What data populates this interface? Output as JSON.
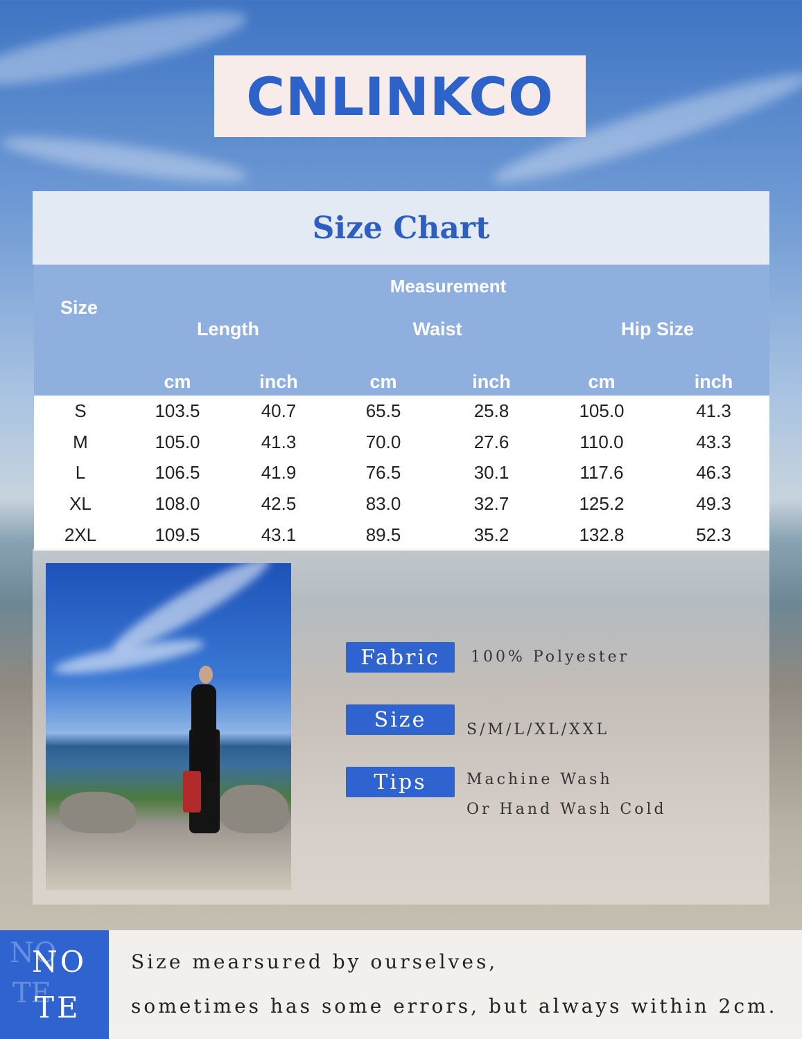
{
  "brand": {
    "name": "CNLINKCO"
  },
  "size_chart": {
    "title": "Size Chart",
    "header_measurement": "Measurement",
    "header_size": "Size",
    "groups": [
      "Length",
      "Waist",
      "Hip Size"
    ],
    "units": [
      "cm",
      "inch",
      "cm",
      "inch",
      "cm",
      "inch"
    ],
    "rows": [
      {
        "size": "S",
        "values": [
          "103.5",
          "40.7",
          "65.5",
          "25.8",
          "105.0",
          "41.3"
        ]
      },
      {
        "size": "M",
        "values": [
          "105.0",
          "41.3",
          "70.0",
          "27.6",
          "110.0",
          "43.3"
        ]
      },
      {
        "size": "L",
        "values": [
          "106.5",
          "41.9",
          "76.5",
          "30.1",
          "117.6",
          "46.3"
        ]
      },
      {
        "size": "XL",
        "values": [
          "108.0",
          "42.5",
          "83.0",
          "32.7",
          "125.2",
          "49.3"
        ]
      },
      {
        "size": "2XL",
        "values": [
          "109.5",
          "43.1",
          "89.5",
          "35.2",
          "132.8",
          "52.3"
        ]
      }
    ]
  },
  "product_info": {
    "fabric_label": "Fabric",
    "fabric_value": "100% Polyester",
    "size_label": "Size",
    "size_value": "S/M/L/XL/XXL",
    "tips_label": "Tips",
    "tips_line1": "Machine Wash",
    "tips_line2": "Or Hand Wash Cold"
  },
  "note": {
    "ghost_line1": "NO",
    "ghost_line2": "TE",
    "word_line1": "NO",
    "word_line2": "TE",
    "line1": "Size mearsured by ourselves,",
    "line2": "sometimes has some errors, but always within 2cm."
  },
  "colors": {
    "brand_blue": "#2d62c9",
    "table_header": "#8fb0de",
    "label_blue": "#2f63d0"
  }
}
